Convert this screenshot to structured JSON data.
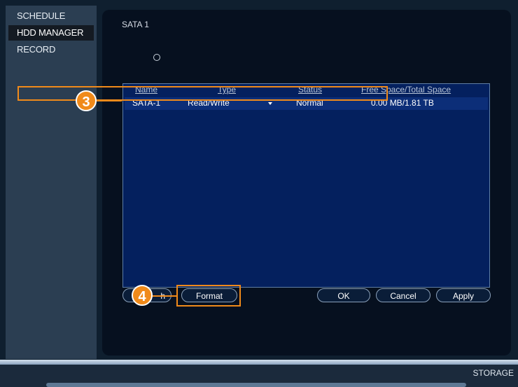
{
  "sidebar": {
    "items": [
      {
        "label": "SCHEDULE",
        "active": false
      },
      {
        "label": "HDD MANAGER",
        "active": true
      },
      {
        "label": "RECORD",
        "active": false
      }
    ]
  },
  "main": {
    "title": "SATA 1",
    "table": {
      "headers": [
        "Name",
        "Type",
        "Status",
        "Free Space/Total Space"
      ],
      "rows": [
        {
          "name": "SATA-1",
          "type": "Read/Write",
          "status": "Normal",
          "space": "0.00 MB/1.81 TB"
        }
      ]
    },
    "buttons": {
      "refresh": "h",
      "format": "Format",
      "ok": "OK",
      "cancel": "Cancel",
      "apply": "Apply"
    }
  },
  "callouts": {
    "row_callout": "3",
    "format_callout": "4"
  },
  "footer": {
    "label": "STORAGE"
  },
  "colors": {
    "accent": "#f08a1a",
    "table_bg": "#04205e",
    "panel_bg": "#06101f"
  }
}
